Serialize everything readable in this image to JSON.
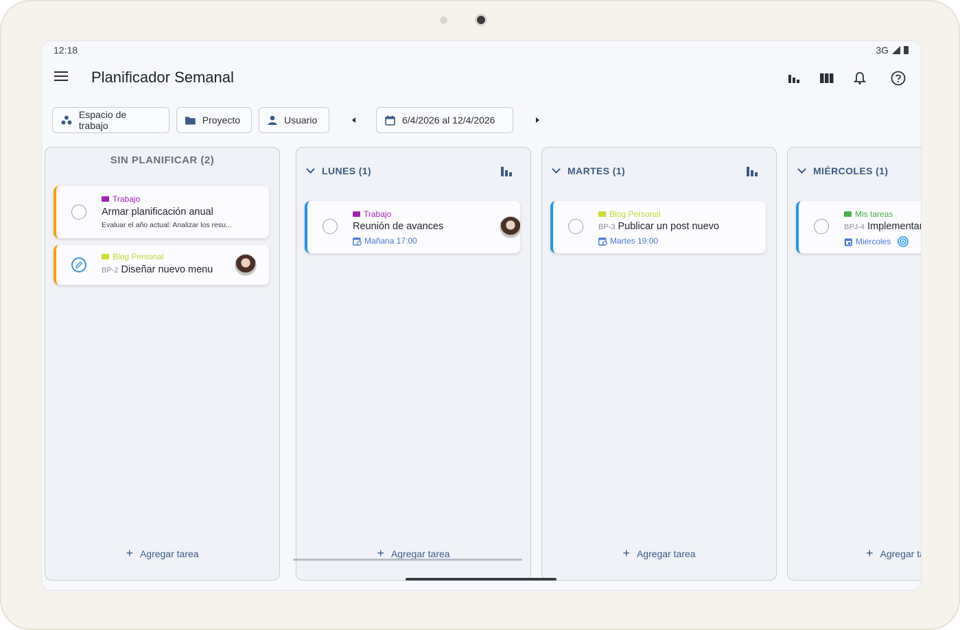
{
  "status": {
    "time": "12:18",
    "network": "3G"
  },
  "appbar": {
    "title": "Planificador Semanal",
    "icons": [
      "bar-chart-icon",
      "columns-icon",
      "bell-icon",
      "help-icon"
    ]
  },
  "filters": {
    "workspace": "Espacio de trabajo",
    "project": "Proyecto",
    "user": "Usuario",
    "date_range": "6/4/2026 al 12/4/2026"
  },
  "columns": [
    {
      "title": "SIN PLANIFICAR (2)",
      "add_label": "Agregar tarea",
      "cards": [
        {
          "project": "Trabajo",
          "project_color": "#9c27b0",
          "name": "Armar planificación anual",
          "desc": "Evaluar el año actual: Analizar los resu..."
        },
        {
          "project": "Blog Personal",
          "project_color": "#cddc39",
          "key": "BP-2",
          "name": "Diseñar nuevo menu"
        }
      ]
    },
    {
      "title": "LUNES (1)",
      "add_label": "Agregar tarea",
      "cards": [
        {
          "project": "Trabajo",
          "project_color": "#9c27b0",
          "name": "Reunión de avances",
          "date": "Mañana 17:00"
        }
      ]
    },
    {
      "title": "MARTES (1)",
      "add_label": "Agregar tarea",
      "cards": [
        {
          "project": "Blog Personal",
          "project_color": "#cddc39",
          "key": "BP-3",
          "name": "Publicar un post nuevo",
          "date": "Martes 19:00"
        }
      ]
    },
    {
      "title": "MIÉRCOLES (1)",
      "add_label": "Agregar tarea",
      "cards": [
        {
          "project": "Mis tareas",
          "project_color": "#4caf50",
          "key": "BPJ-4",
          "name": "Implementar",
          "date": "Miércoles"
        }
      ]
    }
  ],
  "colors": {
    "accent": "#3c5a86",
    "unplanned_bar": "#f59e0b",
    "day_bar": "#2196f3",
    "date_blue": "#4a77d8"
  }
}
